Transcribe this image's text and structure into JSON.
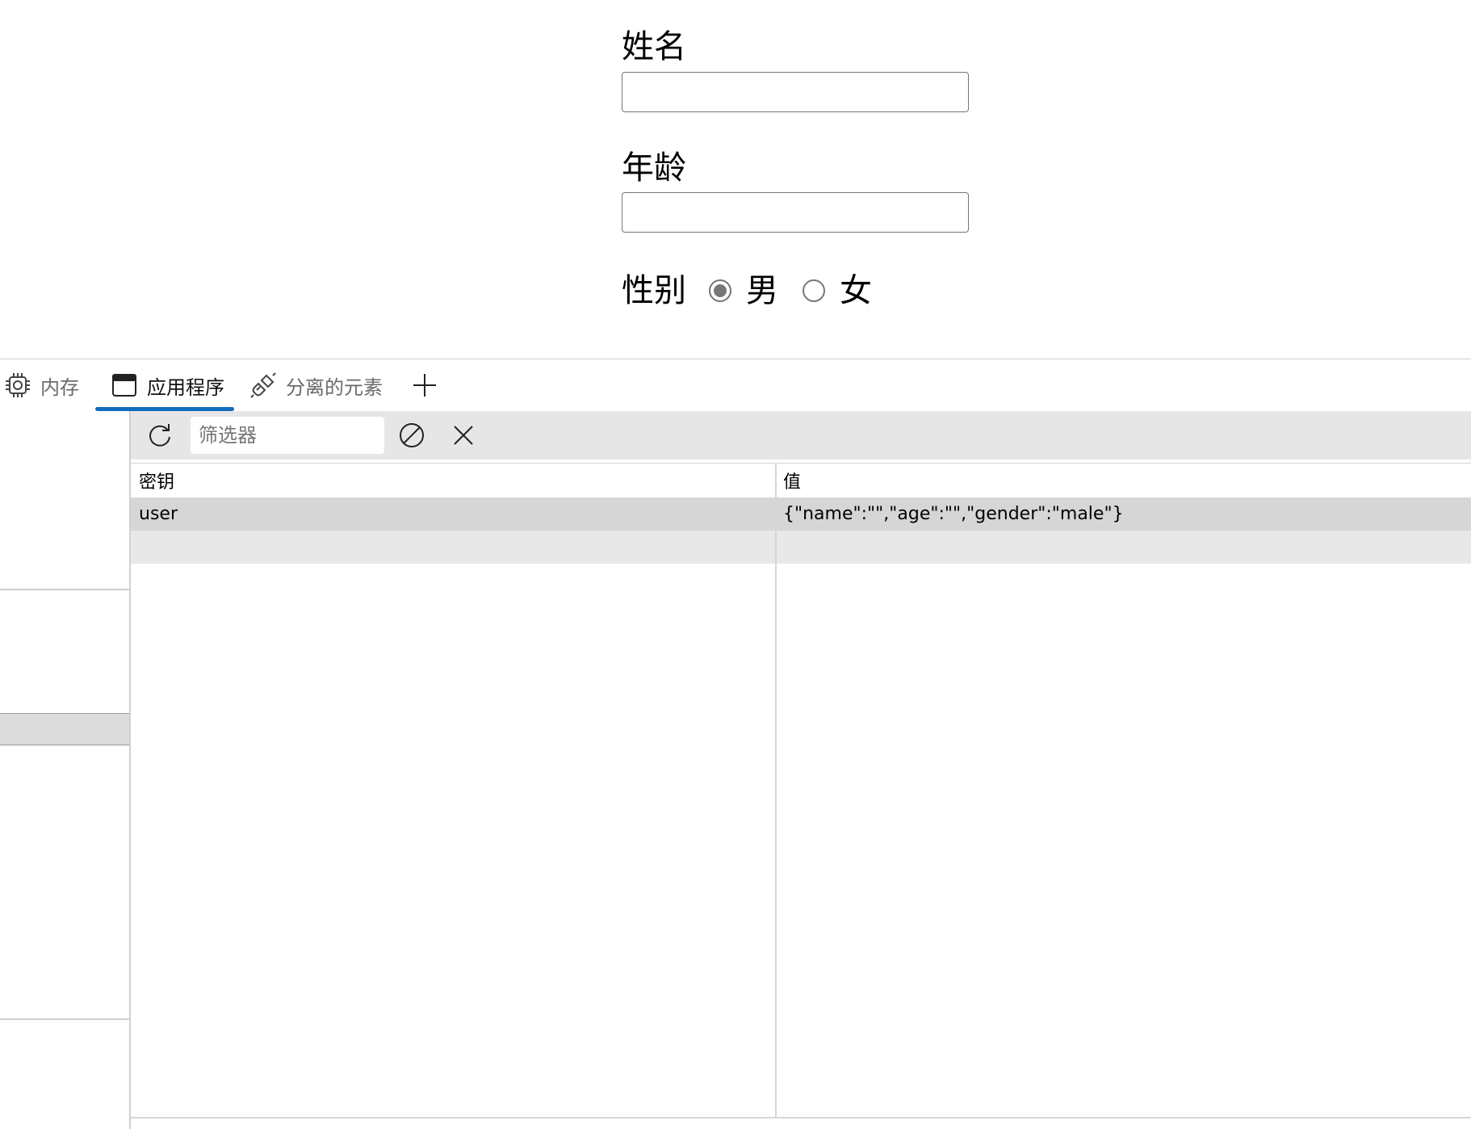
{
  "form": {
    "name_label": "姓名",
    "name_value": "",
    "age_label": "年龄",
    "age_value": "",
    "gender_label": "性别",
    "gender_options": [
      {
        "label": "男",
        "selected": true
      },
      {
        "label": "女",
        "selected": false
      }
    ]
  },
  "devtools": {
    "tabs": [
      {
        "label": "内存",
        "icon": "memory-chip-icon",
        "active": false
      },
      {
        "label": "应用程序",
        "icon": "application-window-icon",
        "active": true
      },
      {
        "label": "分离的元素",
        "icon": "detached-plug-icon",
        "active": false
      }
    ],
    "add_tab_icon": "plus-icon",
    "accent_color": "#0f6cbd",
    "toolbar": {
      "refresh_icon": "refresh-icon",
      "filter_placeholder": "筛选器",
      "clear_all_icon": "clear-all-icon",
      "delete_icon": "close-icon"
    },
    "table": {
      "columns": [
        "密钥",
        "值"
      ],
      "rows": [
        {
          "key": "user",
          "value": "{\"name\":\"\",\"age\":\"\",\"gender\":\"male\"}"
        }
      ]
    }
  }
}
